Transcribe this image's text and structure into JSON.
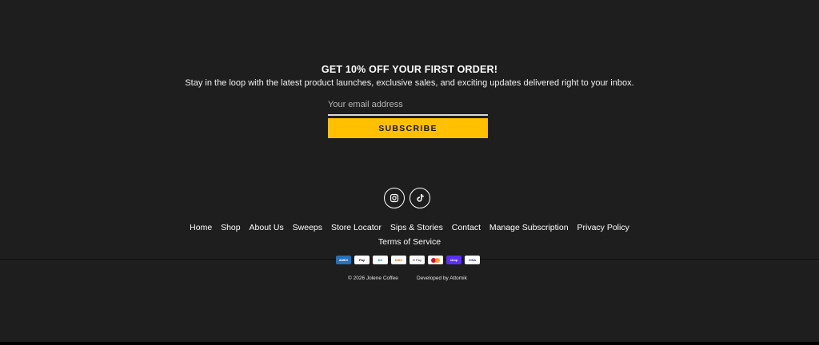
{
  "newsletter": {
    "title": "GET 10% OFF YOUR FIRST ORDER!",
    "subtitle": "Stay in the loop with the latest product launches, exclusive sales, and exciting updates delivered right to your inbox.",
    "email_placeholder": "Your email address",
    "subscribe_label": "SUBSCRIBE"
  },
  "social": [
    "instagram-icon",
    "tiktok-icon"
  ],
  "footer_nav": {
    "home": "Home",
    "shop": "Shop",
    "about": "About Us",
    "sweeps": "Sweeps",
    "store_locator": "Store Locator",
    "sips_stories": "Sips & Stories",
    "contact": "Contact",
    "manage_subscription": "Manage Subscription",
    "privacy_policy": "Privacy Policy",
    "terms": "Terms of Service"
  },
  "payments": {
    "amex": "AMEX",
    "apple_pay": "Pay",
    "diners": "DC",
    "discover": "DISC",
    "google_pay": "G Pay",
    "mastercard": "",
    "shop_pay": "shop",
    "visa": "VISA"
  },
  "footer": {
    "copyright": "© 2026 Jolene Coffee",
    "developed": "Developed by Attomik"
  },
  "colors": {
    "background": "#1e1e1e",
    "accent": "#ffc000"
  }
}
